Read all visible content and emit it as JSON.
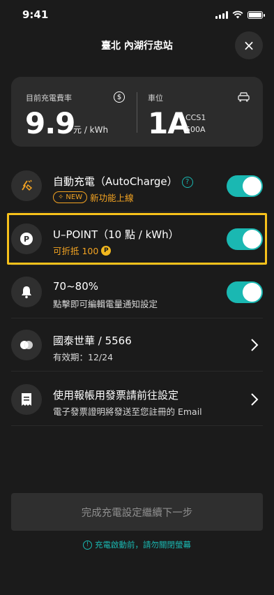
{
  "status": {
    "time": "9:41"
  },
  "header": {
    "title": "臺北 內湖行忠站",
    "close_icon": "×"
  },
  "rate_card": {
    "rate_label": "目前充電費率",
    "rate_value": "9.9",
    "rate_unit": "元 / kWh",
    "spot_label": "車位",
    "spot_value": "1A",
    "connector": "CCS1",
    "current": "500A"
  },
  "rows": [
    {
      "title": "自動充電（AutoCharge）",
      "badge": "NEW",
      "subtitle": "新功能上線",
      "control": "toggle",
      "on": true
    },
    {
      "title": "U–POINT（10 點 / kWh）",
      "subtitle": "可折抵 100",
      "coin": "P",
      "control": "toggle",
      "on": true
    },
    {
      "title": "70~80%",
      "subtitle": "點擊即可編輯電量通知設定",
      "control": "toggle",
      "on": true
    },
    {
      "title": "國泰世華 / 5566",
      "subtitle": "有效期：12/24",
      "control": "chevron"
    },
    {
      "title": "使用報帳用發票請前往設定",
      "subtitle": "電子發票證明將發送至您註冊的 Email",
      "control": "chevron"
    }
  ],
  "footer": {
    "next_label": "完成充電設定繼續下一步",
    "warning": "充電啟動前，請勿關閉螢幕"
  },
  "colors": {
    "accent": "#1ab8b2",
    "orange": "#f3a322",
    "highlight": "#f7c11b",
    "background": "#1b1b1b"
  }
}
